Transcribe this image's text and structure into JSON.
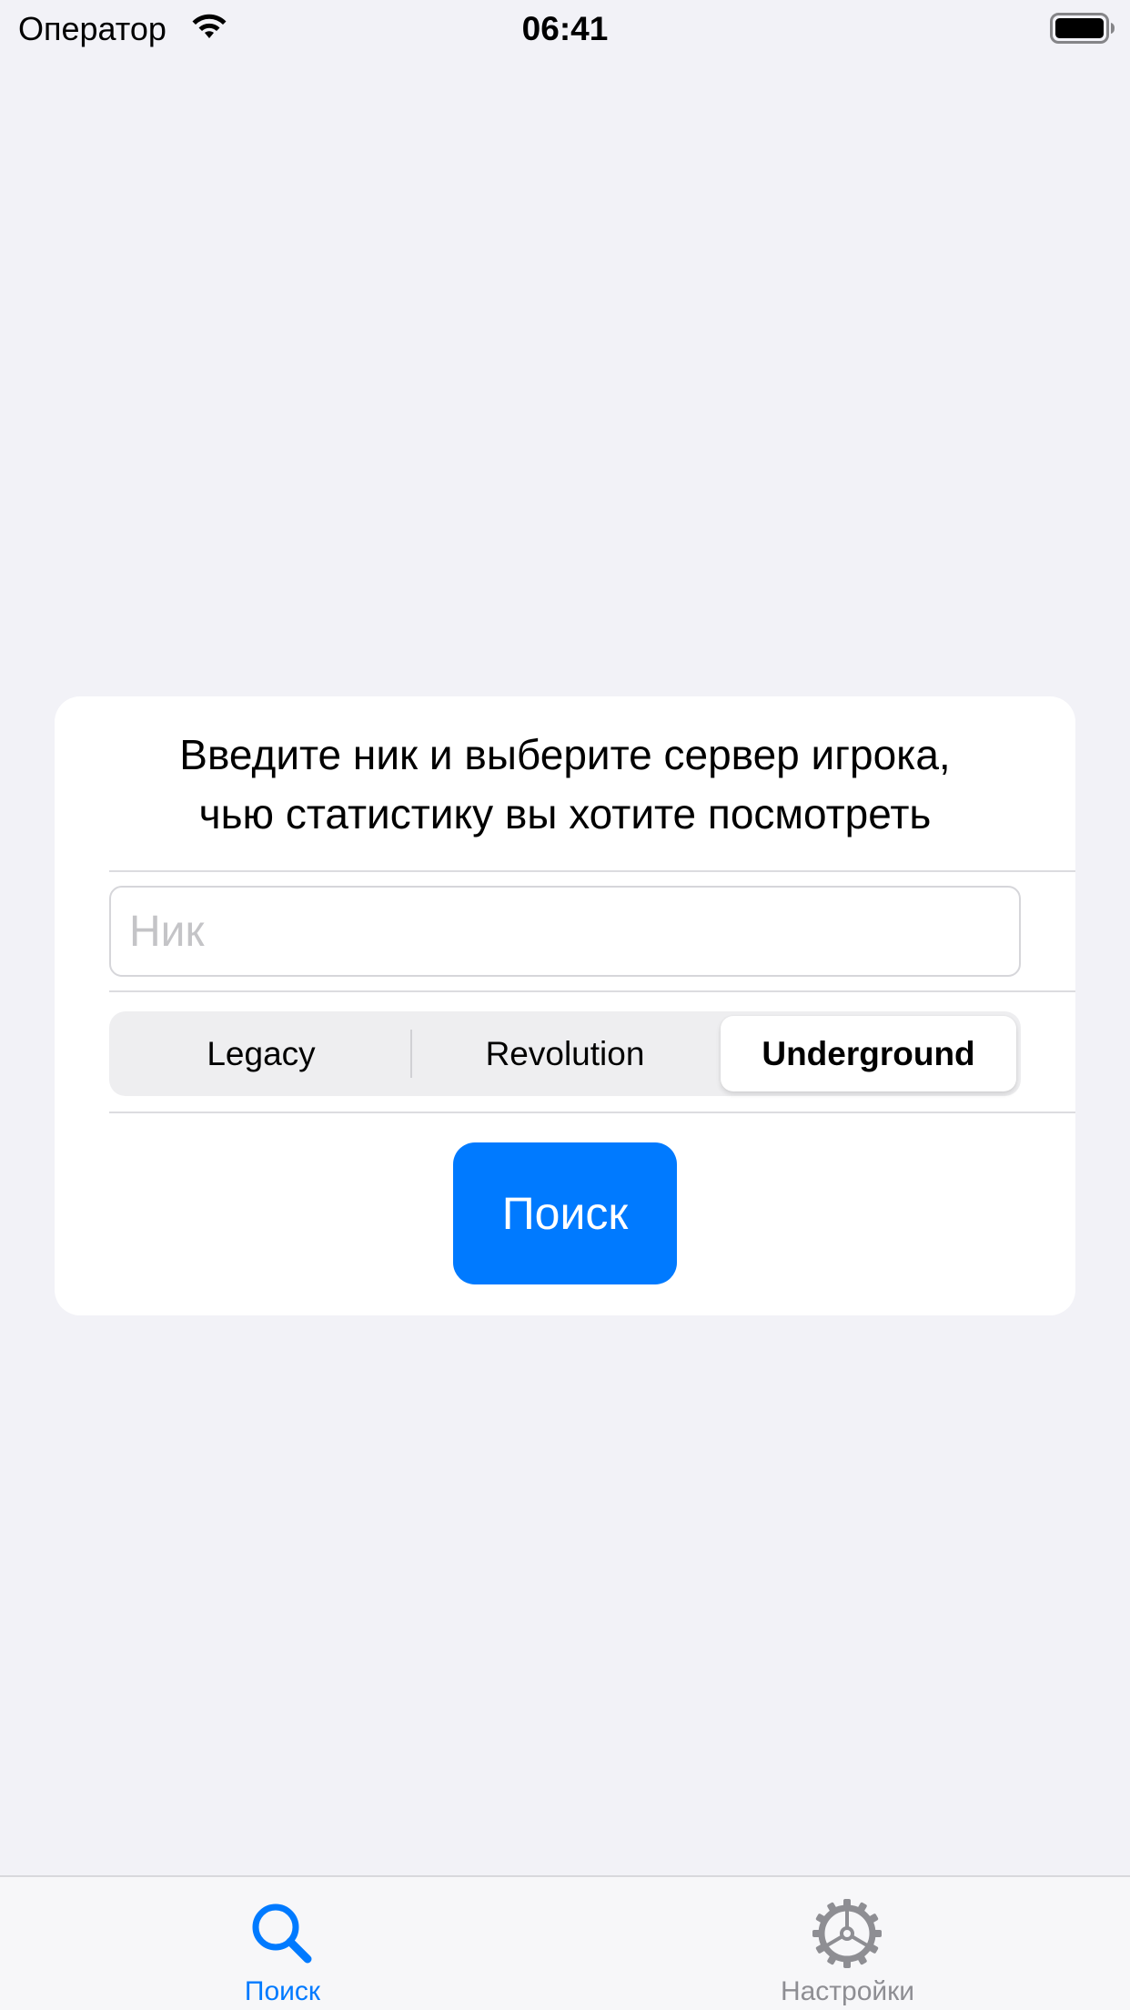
{
  "status_bar": {
    "carrier": "Оператор",
    "time": "06:41",
    "wifi_icon": "wifi-icon",
    "battery_icon": "battery-full-icon"
  },
  "card": {
    "prompt_line1": "Введите ник и выберите сервер игрока,",
    "prompt_line2": "чью статистику вы хотите посмотреть",
    "nick_field": {
      "value": "",
      "placeholder": "Ник"
    },
    "server_segments": {
      "options": [
        "Legacy",
        "Revolution",
        "Underground"
      ],
      "selected": "Underground"
    },
    "search_button_label": "Поиск"
  },
  "tab_bar": {
    "items": [
      {
        "label": "Поиск",
        "icon": "magnifier-icon",
        "active": true
      },
      {
        "label": "Настройки",
        "icon": "gear-icon",
        "active": false
      }
    ]
  },
  "colors": {
    "accent": "#007AFF",
    "background": "#F2F2F7",
    "card": "#FFFFFF",
    "inactive_tab": "#8E8E93",
    "placeholder": "#C4C4C7"
  }
}
